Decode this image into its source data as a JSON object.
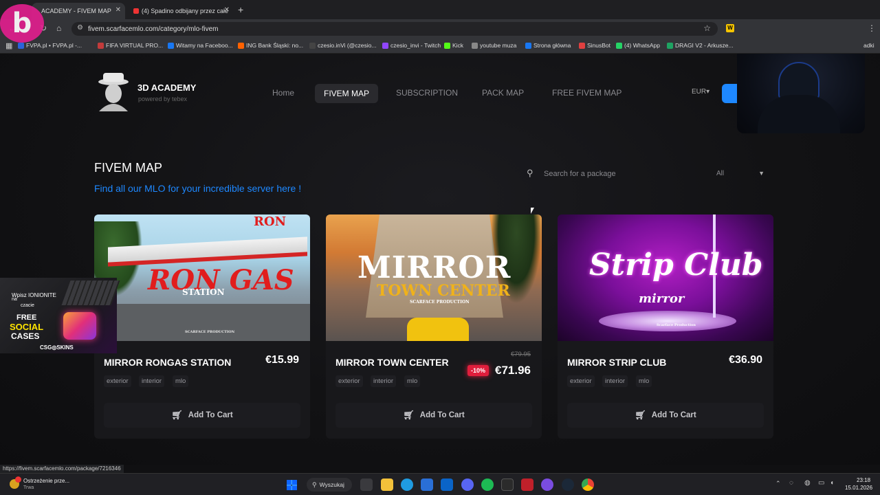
{
  "browser": {
    "tabs": [
      {
        "title": "ACADEMY - FIVEM MAP",
        "active": true
      },
      {
        "title": "(4) Spadino odbijany przez całe",
        "active": false
      }
    ],
    "url": "fivem.scarfacemlo.com/category/mlo-fivem",
    "bookmarks": [
      {
        "label": "FVPA.pl • FVPA.pl -...",
        "color": "#2b63d9"
      },
      {
        "label": "FIFA VIRTUAL PRO...",
        "color": "#c23b3b"
      },
      {
        "label": "Witamy na Faceboo...",
        "color": "#1877f2"
      },
      {
        "label": "ING Bank Śląski: no...",
        "color": "#ff6200"
      },
      {
        "label": "czesio.inVi (@czesio...",
        "color": "#444"
      },
      {
        "label": "czesio_invi - Twitch",
        "color": "#9146ff"
      },
      {
        "label": "Kick",
        "color": "#53fc18"
      },
      {
        "label": "youtube muza",
        "color": "#888"
      },
      {
        "label": "Strona główna",
        "color": "#1877f2"
      },
      {
        "label": "SinusBot",
        "color": "#e04040"
      },
      {
        "label": "(4) WhatsApp",
        "color": "#25d366"
      },
      {
        "label": "DRAGI V2 - Arkusze...",
        "color": "#1ea362"
      }
    ],
    "all_bookmarks_fragment": "adki"
  },
  "site": {
    "brand": "3D ACADEMY",
    "brand_sub": "powered by tebex",
    "nav": [
      "Home",
      "FIVEM MAP",
      "SUBSCRIPTION",
      "PACK MAP",
      "FREE FIVEM MAP"
    ],
    "active_nav": "FIVEM MAP",
    "currency": "EUR",
    "page_title": "FIVEM MAP",
    "page_subtitle": "Find all our MLO for your incredible server here !",
    "search_placeholder": "Search for a package",
    "filter_value": "All",
    "accent": "#1e88ff"
  },
  "products": [
    {
      "name": "MIRROR RONGAS STATION",
      "price": "€15.99",
      "old_price": "",
      "discount": "",
      "tags": [
        "exterior",
        "interior",
        "mlo"
      ],
      "button": "Add To Cart",
      "image_text": [
        "RON GAS",
        "STATION",
        "SCARFACE PRODUCTION",
        "RON"
      ]
    },
    {
      "name": "MIRROR TOWN CENTER",
      "price": "€71.96",
      "old_price": "€79.95",
      "discount": "-10%",
      "tags": [
        "exterior",
        "interior",
        "mlo"
      ],
      "button": "Add To Cart",
      "image_text": [
        "MIRROR",
        "TOWN CENTER",
        "SCARFACE PRODUCTION"
      ]
    },
    {
      "name": "MIRROR STRIP CLUB",
      "price": "€36.90",
      "old_price": "",
      "discount": "",
      "tags": [
        "exterior",
        "interior",
        "mlo"
      ],
      "button": "Add To Cart",
      "image_text": [
        "Strip Club",
        "mirror",
        "Scarface Production"
      ]
    }
  ],
  "overlay": {
    "promo_lines": [
      "Wpisz IONIONITE",
      "na",
      "czacie"
    ],
    "promo_big": [
      "FREE",
      "SOCIAL",
      "CASES"
    ],
    "promo_brand": "CSG◎SKINS"
  },
  "status_url": "https://fivem.scarfacemlo.com/package/7216346",
  "taskbar": {
    "notification": "Ostrzeżenie prze...",
    "notification_sub": "Trwa",
    "search_label": "Wyszukaj",
    "time": "23:18",
    "date": "15.01.2026"
  }
}
